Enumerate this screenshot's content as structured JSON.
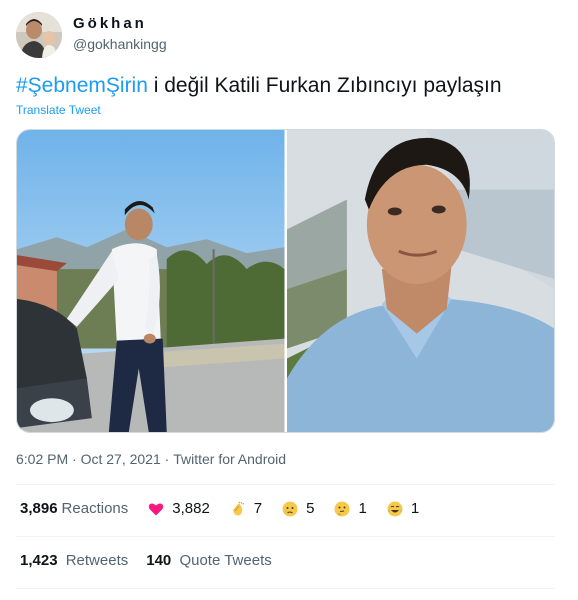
{
  "author": {
    "display_name": "Gökhan",
    "handle": "@gokhankingg"
  },
  "tweet": {
    "hashtag": "#ŞebnemŞirin",
    "text": " i değil Katili Furkan Zıbıncıyı paylaşın",
    "translate_label": "Translate Tweet"
  },
  "meta": {
    "time": "6:02 PM",
    "separator": " · ",
    "date": "Oct 27, 2021",
    "source": "Twitter for Android"
  },
  "reactions": {
    "total": "3,896",
    "label": "Reactions",
    "items": [
      {
        "icon": "heart-icon",
        "count": "3,882",
        "color": "#f91880"
      },
      {
        "icon": "clapping-hands-icon",
        "count": "7"
      },
      {
        "icon": "crying-face-icon",
        "count": "5"
      },
      {
        "icon": "thinking-face-icon",
        "count": "1"
      },
      {
        "icon": "laughing-face-icon",
        "count": "1"
      }
    ]
  },
  "stats": {
    "retweets": "1,423",
    "retweets_label": "Retweets",
    "quote_tweets": "140",
    "quote_tweets_label": "Quote Tweets"
  },
  "colors": {
    "accent": "#1d9bf0",
    "secondary_text": "#536471",
    "border": "#eff3f4"
  }
}
